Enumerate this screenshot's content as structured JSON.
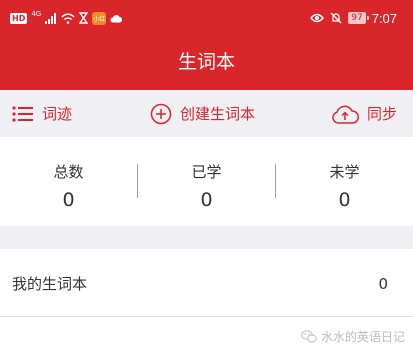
{
  "status_bar": {
    "hd": "HD",
    "signal_label": "4G",
    "app_badge": "小红",
    "battery": "97",
    "time": "7:07"
  },
  "header": {
    "title": "生词本"
  },
  "toolbar": {
    "words_label": "词迹",
    "create_label": "创建生词本",
    "sync_label": "同步"
  },
  "stats": [
    {
      "label": "总数",
      "value": "0"
    },
    {
      "label": "已学",
      "value": "0"
    },
    {
      "label": "未学",
      "value": "0"
    }
  ],
  "wordbooks": [
    {
      "name": "我的生词本",
      "count": "0"
    }
  ],
  "watermark": {
    "text": "水水的英语日记"
  },
  "colors": {
    "brand_red": "#d8262b",
    "toolbar_bg": "#efeff4"
  },
  "icons": {
    "list": "list-icon",
    "add": "add-circle-icon",
    "sync": "cloud-upload-icon"
  }
}
